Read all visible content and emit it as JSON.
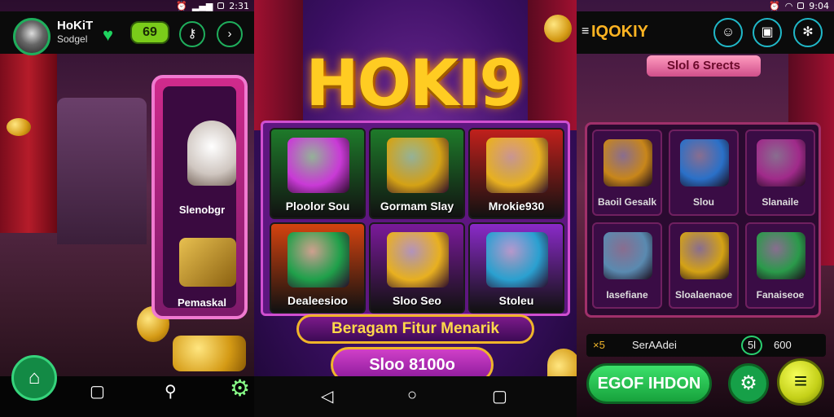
{
  "left": {
    "status_time": "2:31",
    "brand_name": "HoKiT",
    "brand_sub": "Sodgel",
    "coin_pill": "69",
    "symbols": [
      {
        "label": "Slenobgr"
      },
      {
        "label": "Pemaskal"
      }
    ]
  },
  "center": {
    "logo": "HOKI9",
    "cells": [
      {
        "label": "Ploolor Sou",
        "bg": "#1e7a2a",
        "art": "#c93ad6"
      },
      {
        "label": "Gormam Slay",
        "bg": "#1e7a2a",
        "art": "#d4a215"
      },
      {
        "label": "Mrokie930",
        "bg": "#c0201c",
        "art": "#e8b020"
      },
      {
        "label": "Dealeesioo",
        "bg": "#d4430f",
        "art": "#1fa04a"
      },
      {
        "label": "Sloo Seo",
        "bg": "#7a1a9a",
        "art": "#e8b020"
      },
      {
        "label": "Stoleu",
        "bg": "#8a2ac8",
        "art": "#2aa0d0"
      }
    ],
    "banner": "Beragam Fitur Menarik",
    "cta": "Sloo 8100o"
  },
  "right": {
    "status_time": "9:04",
    "title": "IQOKIY",
    "heading": "Slol 6 Srects",
    "cells": [
      {
        "label": "Baoil Gesalk",
        "art": "#c8861a"
      },
      {
        "label": "Slou",
        "art": "#2a70c8"
      },
      {
        "label": "Slanaile",
        "art": "#a02a8a"
      },
      {
        "label": "Iasefiane",
        "art": "#5a8ab0"
      },
      {
        "label": "Sloalaenaoe",
        "art": "#d4a215"
      },
      {
        "label": "Fanaiseoe",
        "art": "#2a9a4a"
      }
    ],
    "info": {
      "left_badge": "×5",
      "name": "SerAAdei",
      "code": "5l",
      "amount": "600"
    },
    "primary_button": "EGOF IHDON"
  }
}
